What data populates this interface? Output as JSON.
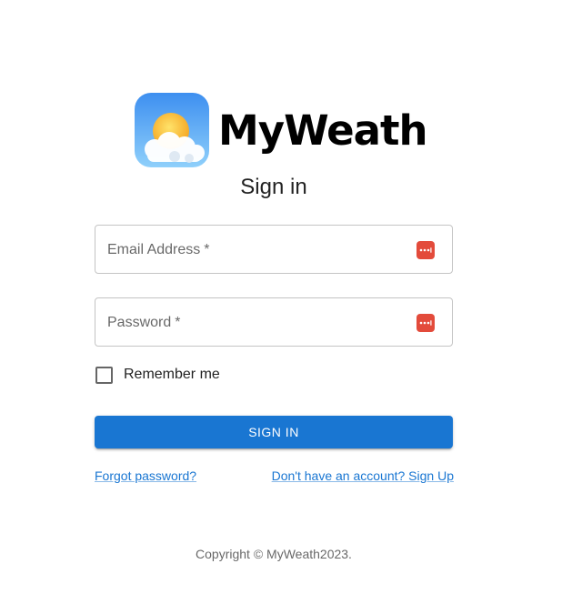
{
  "brand": {
    "name": "MyWeath",
    "logo_icon": "sun-cloud-icon"
  },
  "form": {
    "title": "Sign in",
    "email": {
      "label": "Email Address",
      "required_mark": "*",
      "value": "",
      "autofill_icon": "password-manager-icon"
    },
    "password": {
      "label": "Password",
      "required_mark": "*",
      "value": "",
      "autofill_icon": "password-manager-icon"
    },
    "remember": {
      "label": "Remember me",
      "checked": false
    },
    "submit_label": "Sign In",
    "forgot_link": "Forgot password?",
    "signup_link": "Don't have an account? Sign Up"
  },
  "footer": {
    "copyright": "Copyright © MyWeath2023."
  },
  "colors": {
    "primary": "#1976d2",
    "autofill_icon": "#e34b3b"
  }
}
